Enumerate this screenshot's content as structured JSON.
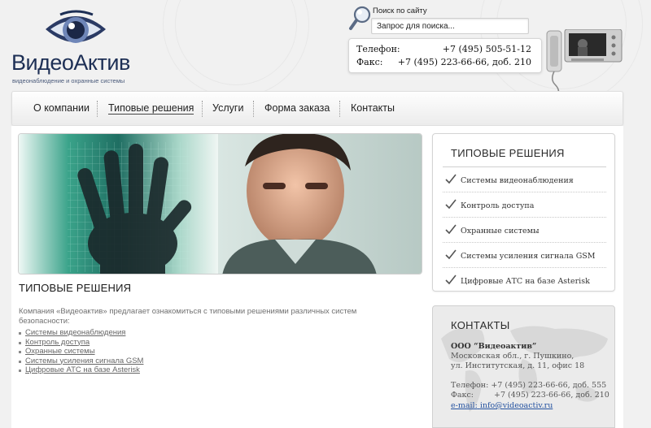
{
  "logo": {
    "name": "ВидеоАктив",
    "tagline": "видеонаблюдение и охранные системы"
  },
  "search": {
    "label": "Поиск по сайту",
    "value": "Запрос для поиска..."
  },
  "contacts_header": {
    "phone_label": "Телефон:",
    "phone_value": "+7 (495) 505-51-12",
    "fax_label": "Факс:",
    "fax_value": "+7 (495) 223-66-66, доб. 210"
  },
  "nav": {
    "items": [
      {
        "label": "О компании"
      },
      {
        "label": "Типовые решения"
      },
      {
        "label": "Услуги"
      },
      {
        "label": "Форма заказа"
      },
      {
        "label": "Контакты"
      }
    ]
  },
  "main": {
    "title": "ТИПОВЫЕ РЕШЕНИЯ",
    "intro": "Компания «Видеоактив» предлагает ознакомиться с типовыми решениями различных систем безопасности:",
    "links": [
      "Системы видеонаблюдения",
      "Контроль доступа",
      "Охранные системы",
      "Системы усиления сигнала GSM",
      "Цифровые АТС на базе Asterisk"
    ]
  },
  "solutions_box": {
    "title": "ТИПОВЫЕ РЕШЕНИЯ",
    "items": [
      "Системы видеонаблюдения",
      "Контроль доступа",
      "Охранные системы",
      "Системы усиления сигнала GSM",
      "Цифровые АТС на базе Asterisk"
    ]
  },
  "contacts_box": {
    "title": "КОНТАКТЫ",
    "company": "ООО “Видеоактив”",
    "address1": "Московская обл., г. Пушкино,",
    "address2": "ул. Институтская, д. 11, офис 18",
    "phone_label": "Телефон:",
    "phone_value": "+7 (495) 223-66-66, доб. 555",
    "fax_label": "Факс:",
    "fax_value": "+7 (495) 223-66-66, доб. 210",
    "email_label": "e-mail:",
    "email_value": "info@videoactiv.ru"
  },
  "colors": {
    "accent": "#1d2f55",
    "link": "#2452a0",
    "banner_teal": "#2f8f7a"
  }
}
